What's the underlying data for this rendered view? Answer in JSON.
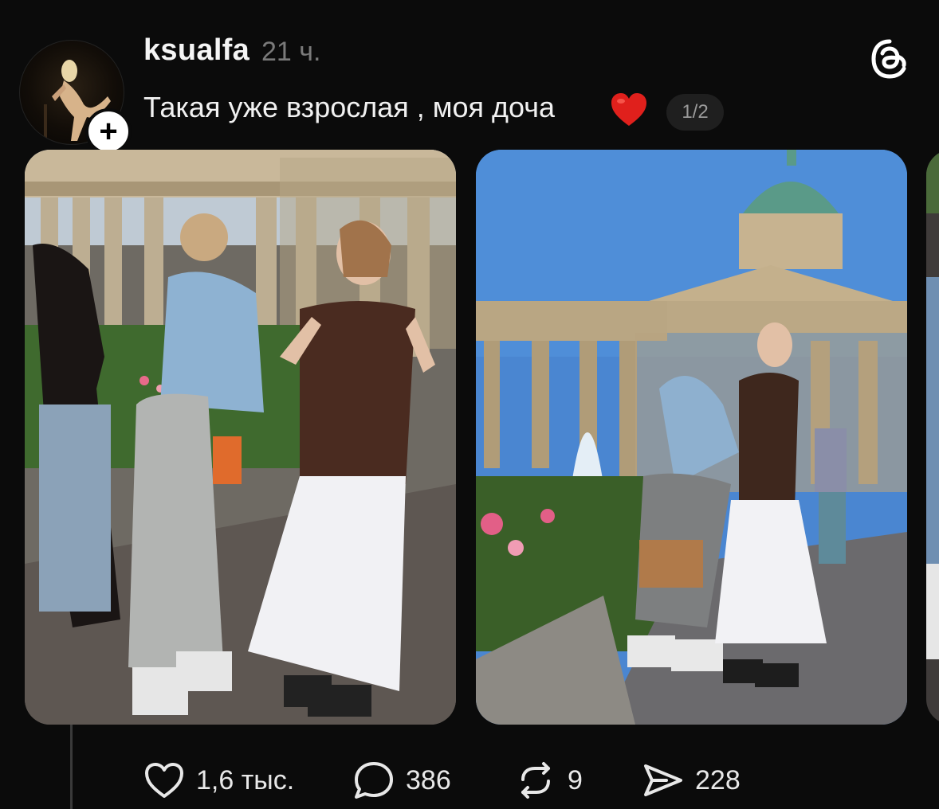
{
  "post": {
    "username": "ksualfa",
    "time": "21 ч.",
    "caption": "Такая уже взрослая , моя доча",
    "caption_emoji": "red-heart",
    "page_indicator": "1/2"
  },
  "actions": {
    "likes": "1,6 тыс.",
    "comments": "386",
    "reposts": "9",
    "shares": "228"
  },
  "icons": {
    "like": "heart-icon",
    "comment": "comment-bubble-icon",
    "repost": "repost-icon",
    "share": "send-icon",
    "app": "threads-logo-icon",
    "follow": "plus-icon"
  },
  "colors": {
    "background": "#0b0b0b",
    "text": "#f3f3f3",
    "muted": "#7a7a7a",
    "heart": "#e0201c"
  }
}
